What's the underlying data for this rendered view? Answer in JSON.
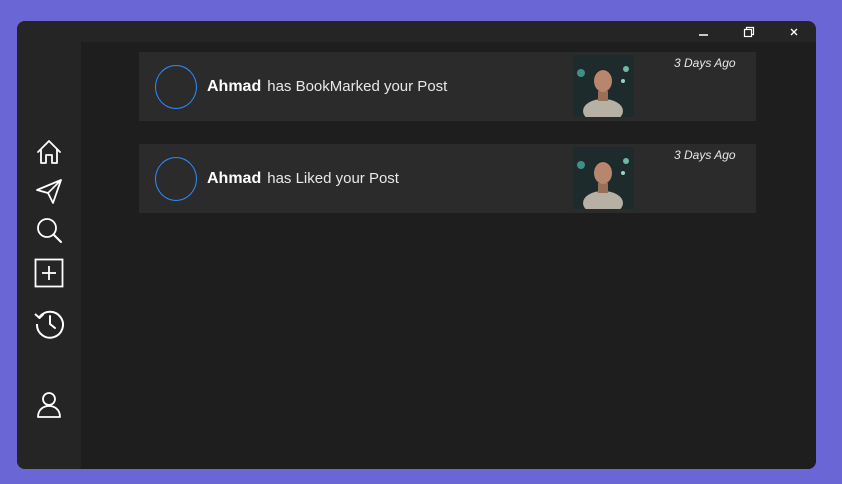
{
  "window": {
    "controls": {
      "minimize_icon": "minimize-icon",
      "maximize_icon": "restore-icon",
      "close_label": "✕"
    }
  },
  "sidebar": {
    "items": [
      {
        "name": "home",
        "icon": "home-icon"
      },
      {
        "name": "send",
        "icon": "paper-plane-icon"
      },
      {
        "name": "search",
        "icon": "search-icon"
      },
      {
        "name": "add-post",
        "icon": "plus-square-icon"
      },
      {
        "name": "history",
        "icon": "history-icon"
      },
      {
        "name": "profile",
        "icon": "user-icon"
      }
    ]
  },
  "notifications": [
    {
      "user": "Ahmad",
      "action": "has BookMarked your Post",
      "time": "3 Days Ago",
      "thumbnail": "post-thumbnail"
    },
    {
      "user": "Ahmad",
      "action": "has Liked your Post",
      "time": "3 Days Ago",
      "thumbnail": "post-thumbnail"
    }
  ],
  "colors": {
    "background": "#6b66d6",
    "window": "#252525",
    "content": "#1e1e1e",
    "card": "#2b2b2b",
    "avatar_ring": "#2e8bff"
  }
}
